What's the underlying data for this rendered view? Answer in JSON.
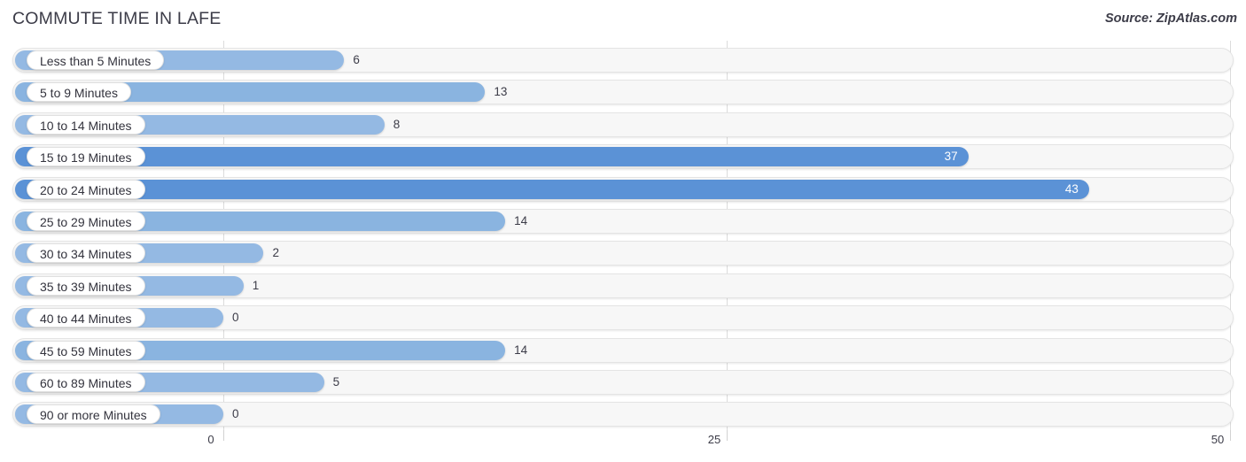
{
  "header": {
    "title": "COMMUTE TIME IN LAFE",
    "source": "Source: ZipAtlas.com"
  },
  "chart_data": {
    "type": "bar",
    "orientation": "horizontal",
    "title": "COMMUTE TIME IN LAFE",
    "xlabel": "",
    "ylabel": "",
    "xlim": [
      0,
      50
    ],
    "ticks": [
      0,
      25,
      50
    ],
    "tick_labels": [
      "0",
      "25",
      "50"
    ],
    "grid": true,
    "legend": null,
    "categories": [
      "Less than 5 Minutes",
      "5 to 9 Minutes",
      "10 to 14 Minutes",
      "15 to 19 Minutes",
      "20 to 24 Minutes",
      "25 to 29 Minutes",
      "30 to 34 Minutes",
      "35 to 39 Minutes",
      "40 to 44 Minutes",
      "45 to 59 Minutes",
      "60 to 89 Minutes",
      "90 or more Minutes"
    ],
    "values": [
      6,
      13,
      8,
      37,
      43,
      14,
      2,
      1,
      0,
      14,
      5,
      0
    ],
    "value_labels": [
      "6",
      "13",
      "8",
      "37",
      "43",
      "14",
      "2",
      "1",
      "0",
      "14",
      "5",
      "0"
    ]
  },
  "colors": {
    "bar_light": "#94b9e3",
    "bar_mid": "#8ab4e0",
    "bar_dark": "#5b92d6",
    "track": "#f7f7f7",
    "gridline": "#dcdcdc",
    "text": "#3c3c48",
    "value_inside": "#ffffff"
  }
}
